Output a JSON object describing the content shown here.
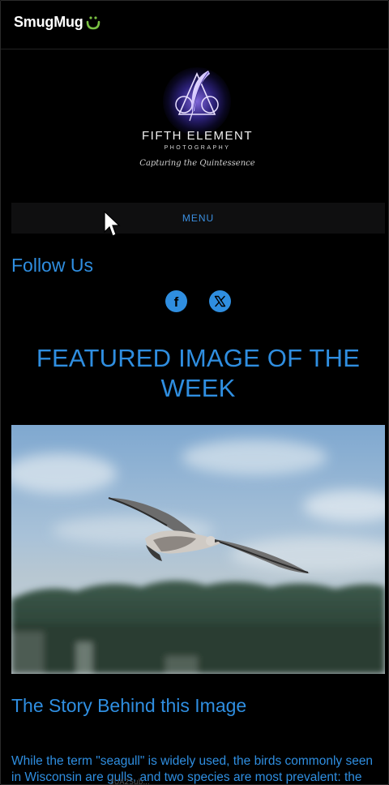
{
  "header": {
    "brand_name": "SmugMug",
    "brand_icon": "smile-icon",
    "brand_accent": "#7ac143"
  },
  "logo": {
    "name": "FIFTH ELEMENT",
    "sub": "PHOTOGRAPHY",
    "tagline": "Capturing the Quintessence",
    "icon": "feather-icon"
  },
  "nav": {
    "menu_label": "MENU"
  },
  "follow": {
    "heading": "Follow Us",
    "links": [
      {
        "name": "facebook",
        "icon": "facebook-icon",
        "glyph": "f"
      },
      {
        "name": "x",
        "icon": "x-icon"
      }
    ]
  },
  "featured": {
    "heading": "FEATURED IMAGE OF THE WEEK",
    "image": "seagull-in-flight"
  },
  "story": {
    "heading": "The Story Behind this Image",
    "line1": "While the term \"seagull\" is widely used, the birds commonly seen",
    "line2": "in Wisconsin are gulls, and two species are most prevalent: the"
  },
  "overlay": {
    "stray_text": "3UA2Sub..."
  },
  "colors": {
    "accent": "#2f8ee0",
    "background": "#000000"
  }
}
